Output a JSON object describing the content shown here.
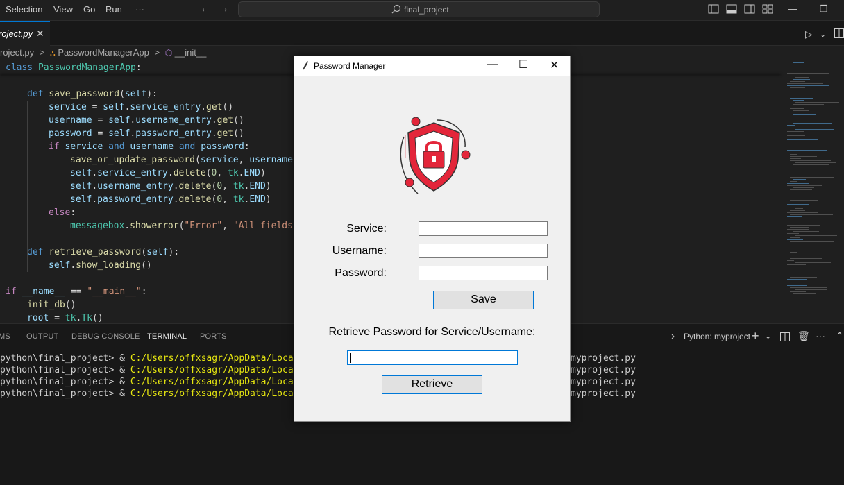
{
  "titlebar": {
    "menu": [
      "Selection",
      "View",
      "Go",
      "Run",
      "···"
    ],
    "search_text": "final_project",
    "window_controls": {
      "minimize": "—",
      "restore": "❐"
    }
  },
  "tab": {
    "label": "roject.py",
    "close": "✕"
  },
  "breadcrumb": {
    "file": "roject.py",
    "sep1": ">",
    "class": "PasswordManagerApp",
    "sep2": ">",
    "method": "__init__"
  },
  "code_lines": [
    {
      "indent": 0,
      "tokens": [
        {
          "t": "class ",
          "c": "kw"
        },
        {
          "t": "PasswordManagerApp",
          "c": "cls"
        },
        {
          "t": ":",
          "c": "plain"
        }
      ]
    },
    {
      "indent": 0,
      "tokens": []
    },
    {
      "indent": 1,
      "tokens": [
        {
          "t": "def ",
          "c": "kw"
        },
        {
          "t": "save_password",
          "c": "fn"
        },
        {
          "t": "(",
          "c": "plain"
        },
        {
          "t": "self",
          "c": "var"
        },
        {
          "t": "):",
          "c": "plain"
        }
      ]
    },
    {
      "indent": 2,
      "tokens": [
        {
          "t": "service",
          "c": "var"
        },
        {
          "t": " = ",
          "c": "plain"
        },
        {
          "t": "self",
          "c": "var"
        },
        {
          "t": ".",
          "c": "plain"
        },
        {
          "t": "service_entry",
          "c": "var"
        },
        {
          "t": ".",
          "c": "plain"
        },
        {
          "t": "get",
          "c": "fn"
        },
        {
          "t": "()",
          "c": "plain"
        }
      ]
    },
    {
      "indent": 2,
      "tokens": [
        {
          "t": "username",
          "c": "var"
        },
        {
          "t": " = ",
          "c": "plain"
        },
        {
          "t": "self",
          "c": "var"
        },
        {
          "t": ".",
          "c": "plain"
        },
        {
          "t": "username_entry",
          "c": "var"
        },
        {
          "t": ".",
          "c": "plain"
        },
        {
          "t": "get",
          "c": "fn"
        },
        {
          "t": "()",
          "c": "plain"
        }
      ]
    },
    {
      "indent": 2,
      "tokens": [
        {
          "t": "password",
          "c": "var"
        },
        {
          "t": " = ",
          "c": "plain"
        },
        {
          "t": "self",
          "c": "var"
        },
        {
          "t": ".",
          "c": "plain"
        },
        {
          "t": "password_entry",
          "c": "var"
        },
        {
          "t": ".",
          "c": "plain"
        },
        {
          "t": "get",
          "c": "fn"
        },
        {
          "t": "()",
          "c": "plain"
        }
      ]
    },
    {
      "indent": 2,
      "tokens": [
        {
          "t": "if ",
          "c": "kw2"
        },
        {
          "t": "service",
          "c": "var"
        },
        {
          "t": " and ",
          "c": "kw"
        },
        {
          "t": "username",
          "c": "var"
        },
        {
          "t": " and ",
          "c": "kw"
        },
        {
          "t": "password",
          "c": "var"
        },
        {
          "t": ":",
          "c": "plain"
        }
      ]
    },
    {
      "indent": 3,
      "tokens": [
        {
          "t": "save_or_update_password",
          "c": "fn"
        },
        {
          "t": "(",
          "c": "plain"
        },
        {
          "t": "service",
          "c": "var"
        },
        {
          "t": ", ",
          "c": "plain"
        },
        {
          "t": "username",
          "c": "var"
        },
        {
          "t": ",",
          "c": "plain"
        }
      ]
    },
    {
      "indent": 3,
      "tokens": [
        {
          "t": "self",
          "c": "var"
        },
        {
          "t": ".",
          "c": "plain"
        },
        {
          "t": "service_entry",
          "c": "var"
        },
        {
          "t": ".",
          "c": "plain"
        },
        {
          "t": "delete",
          "c": "fn"
        },
        {
          "t": "(",
          "c": "plain"
        },
        {
          "t": "0",
          "c": "num"
        },
        {
          "t": ", ",
          "c": "plain"
        },
        {
          "t": "tk",
          "c": "cls"
        },
        {
          "t": ".",
          "c": "plain"
        },
        {
          "t": "END",
          "c": "var"
        },
        {
          "t": ")",
          "c": "plain"
        }
      ]
    },
    {
      "indent": 3,
      "tokens": [
        {
          "t": "self",
          "c": "var"
        },
        {
          "t": ".",
          "c": "plain"
        },
        {
          "t": "username_entry",
          "c": "var"
        },
        {
          "t": ".",
          "c": "plain"
        },
        {
          "t": "delete",
          "c": "fn"
        },
        {
          "t": "(",
          "c": "plain"
        },
        {
          "t": "0",
          "c": "num"
        },
        {
          "t": ", ",
          "c": "plain"
        },
        {
          "t": "tk",
          "c": "cls"
        },
        {
          "t": ".",
          "c": "plain"
        },
        {
          "t": "END",
          "c": "var"
        },
        {
          "t": ")",
          "c": "plain"
        }
      ]
    },
    {
      "indent": 3,
      "tokens": [
        {
          "t": "self",
          "c": "var"
        },
        {
          "t": ".",
          "c": "plain"
        },
        {
          "t": "password_entry",
          "c": "var"
        },
        {
          "t": ".",
          "c": "plain"
        },
        {
          "t": "delete",
          "c": "fn"
        },
        {
          "t": "(",
          "c": "plain"
        },
        {
          "t": "0",
          "c": "num"
        },
        {
          "t": ", ",
          "c": "plain"
        },
        {
          "t": "tk",
          "c": "cls"
        },
        {
          "t": ".",
          "c": "plain"
        },
        {
          "t": "END",
          "c": "var"
        },
        {
          "t": ")",
          "c": "plain"
        }
      ]
    },
    {
      "indent": 2,
      "tokens": [
        {
          "t": "else",
          "c": "kw2"
        },
        {
          "t": ":",
          "c": "plain"
        }
      ]
    },
    {
      "indent": 3,
      "tokens": [
        {
          "t": "messagebox",
          "c": "cls"
        },
        {
          "t": ".",
          "c": "plain"
        },
        {
          "t": "showerror",
          "c": "fn"
        },
        {
          "t": "(",
          "c": "plain"
        },
        {
          "t": "\"Error\"",
          "c": "str"
        },
        {
          "t": ", ",
          "c": "plain"
        },
        {
          "t": "\"All fields",
          "c": "str"
        }
      ]
    },
    {
      "indent": 0,
      "tokens": []
    },
    {
      "indent": 1,
      "tokens": [
        {
          "t": "def ",
          "c": "kw"
        },
        {
          "t": "retrieve_password",
          "c": "fn"
        },
        {
          "t": "(",
          "c": "plain"
        },
        {
          "t": "self",
          "c": "var"
        },
        {
          "t": "):",
          "c": "plain"
        }
      ]
    },
    {
      "indent": 2,
      "tokens": [
        {
          "t": "self",
          "c": "var"
        },
        {
          "t": ".",
          "c": "plain"
        },
        {
          "t": "show_loading",
          "c": "fn"
        },
        {
          "t": "()",
          "c": "plain"
        }
      ]
    },
    {
      "indent": 0,
      "tokens": []
    },
    {
      "indent": 0,
      "tokens": [
        {
          "t": "if ",
          "c": "kw2"
        },
        {
          "t": "__name__",
          "c": "var"
        },
        {
          "t": " == ",
          "c": "plain"
        },
        {
          "t": "\"__main__\"",
          "c": "str"
        },
        {
          "t": ":",
          "c": "plain"
        }
      ]
    },
    {
      "indent": 1,
      "tokens": [
        {
          "t": "init_db",
          "c": "fn"
        },
        {
          "t": "()",
          "c": "plain"
        }
      ]
    },
    {
      "indent": 1,
      "tokens": [
        {
          "t": "root",
          "c": "var"
        },
        {
          "t": " = ",
          "c": "plain"
        },
        {
          "t": "tk",
          "c": "cls"
        },
        {
          "t": ".",
          "c": "plain"
        },
        {
          "t": "Tk",
          "c": "cls"
        },
        {
          "t": "()",
          "c": "plain"
        }
      ]
    }
  ],
  "panel": {
    "tabs": [
      "MS",
      "OUTPUT",
      "DEBUG CONSOLE",
      "TERMINAL",
      "PORTS"
    ],
    "terminal_label": "Python: myproject",
    "prompt": "python\\final_project> & ",
    "path": "C:/Users/offxsagr/AppData/Local/Prog",
    "tail": "myproject.py",
    "line_count": 4
  },
  "tkwindow": {
    "title": "Password Manager",
    "minimize": "—",
    "maximize": "☐",
    "close": "✕",
    "service_label": "Service:",
    "username_label": "Username:",
    "password_label": "Password:",
    "save_button": "Save",
    "retrieve_prompt": "Retrieve Password for Service/Username:",
    "retrieve_button": "Retrieve",
    "service_value": "",
    "username_value": "",
    "password_value": "",
    "retrieve_value": ""
  },
  "colors": {
    "accent": "#0078d4",
    "shield_red": "#e3263a",
    "terminal_path": "#e5e510"
  }
}
